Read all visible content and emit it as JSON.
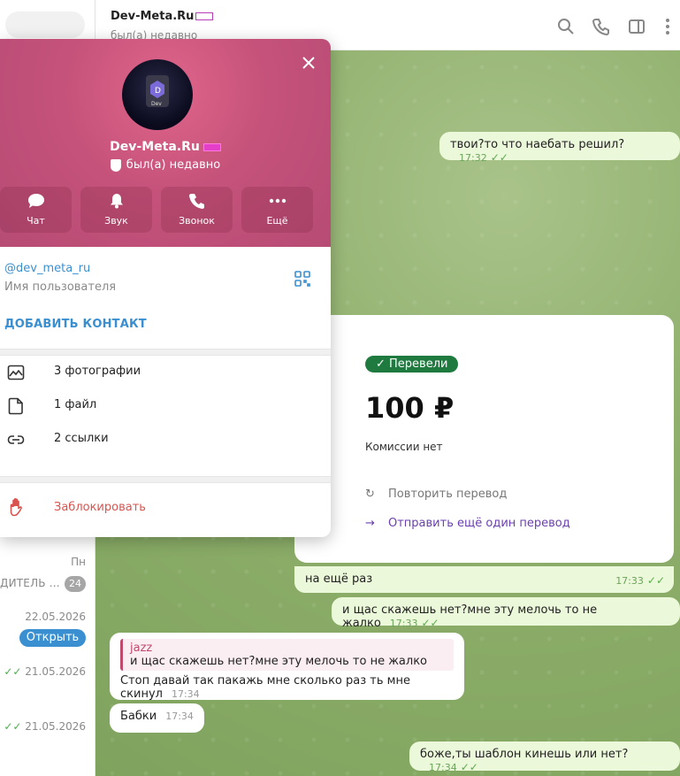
{
  "chat_header": {
    "title": "Dev-Meta.Ru",
    "status": "был(а) недавно"
  },
  "sidebar": {
    "rows": [
      {
        "date": "Пн",
        "snippet": "ДИТЕЛЬ ...",
        "badge": "24"
      },
      {
        "date": "22.05.2026",
        "button": "Открыть"
      },
      {
        "date": "21.05.2026"
      },
      {
        "date": "21.05.2026"
      }
    ]
  },
  "profile": {
    "name": "Dev-Meta.Ru",
    "status": "был(а) недавно",
    "actions": [
      {
        "label": "Чат",
        "icon": "chat-bubble-icon"
      },
      {
        "label": "Звук",
        "icon": "bell-icon"
      },
      {
        "label": "Звонок",
        "icon": "phone-icon"
      },
      {
        "label": "Ещё",
        "icon": "more-dots-icon"
      }
    ],
    "username": "@dev_meta_ru",
    "username_label": "Имя пользователя",
    "add_contact": "ДОБАВИТЬ КОНТАКТ",
    "media": [
      {
        "label": "3 фотографии",
        "icon": "photo-icon"
      },
      {
        "label": "1 файл",
        "icon": "file-icon"
      },
      {
        "label": "2 ссылки",
        "icon": "link-icon"
      }
    ],
    "block": "Заблокировать"
  },
  "messages": [
    {
      "text": "твои?то что наебать решил?",
      "time": "17:32"
    },
    {
      "text": "на ещё раз",
      "time": "17:33"
    },
    {
      "text": "и щас скажешь нет?мне эту мелочь то не жалко",
      "time": "17:33"
    },
    {
      "reply_author": "jazz",
      "reply_text": "и щас скажешь нет?мне эту мелочь то не жалко",
      "text": "Стоп давай так пакажь мне сколько раз ть мне скинул",
      "time": "17:34"
    },
    {
      "text": "Бабки",
      "time": "17:34"
    },
    {
      "text": "боже,ты шаблон кинешь или нет?",
      "time": "17:34"
    }
  ],
  "payment": {
    "status": "Перевели",
    "amount": "100 ₽",
    "fee": "Комиссии нет",
    "repeat": "Повторить перевод",
    "send_again": "Отправить ещё один перевод"
  },
  "avatar_logo_text": "Dev"
}
